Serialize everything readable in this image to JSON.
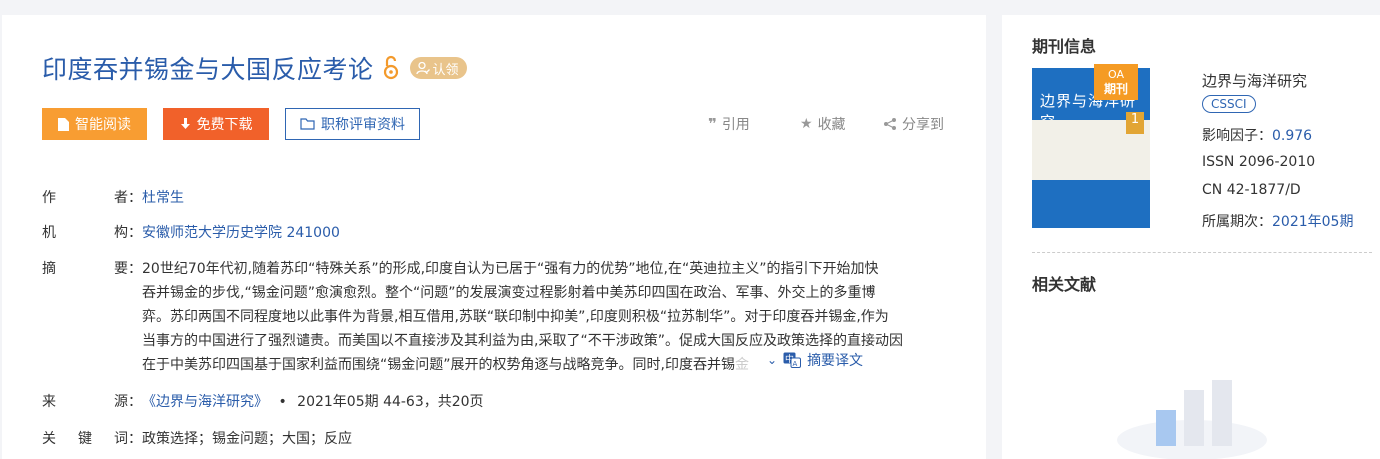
{
  "article": {
    "title": "印度吞并锡金与大国反应考论",
    "claim_label": "认领",
    "buttons": {
      "read": "智能阅读",
      "download": "免费下载",
      "title_material": "职称评审资料"
    },
    "actions": {
      "cite": "引用",
      "favorite": "收藏",
      "share": "分享到"
    },
    "labels": {
      "author": [
        "作",
        "者："
      ],
      "org": [
        "机",
        "构："
      ],
      "abstract": [
        "摘",
        "要："
      ],
      "source": [
        "来",
        "源："
      ],
      "keywords": [
        "关",
        "键",
        "词："
      ]
    },
    "author": "杜常生",
    "org": "安徽师范大学历史学院 241000",
    "abstract_lines": [
      "20世纪70年代初,随着苏印“特殊关系”的形成,印度自认为已居于“强有力的优势”地位,在“英迪拉主义”的指引下开始加快",
      "吞并锡金的步伐,“锡金问题”愈演愈烈。整个“问题”的发展演变过程影射着中美苏印四国在政治、军事、外交上的多重博",
      "弈。苏印两国不同程度地以此事件为背景,相互借用,苏联“联印制中抑美”,印度则积极“拉苏制华”。对于印度吞并锡金,作为",
      "当事方的中国进行了强烈谴责。而美国以不直接涉及其利益为由,采取了“不干涉政策”。促成大国反应及政策选择的直接动因",
      "在于中美苏印四国基于国家利益而围绕“锡金问题”展开的权势角逐与战略竞争。同时,印度吞并锡"
    ],
    "abstract_fade": "金",
    "translate_label": "摘要译文",
    "source_journal": "《边界与海洋研究》",
    "source_issue": "2021年05期 44-63，共20页",
    "keywords": "政策选择；锡金问题；大国；反应"
  },
  "journal": {
    "section_title": "期刊信息",
    "name": "边界与海洋研究",
    "cover_title": "边界与海洋研究",
    "cover_issue": "1",
    "oa_badge_top": "OA",
    "oa_badge_bottom": "期刊",
    "index_tag": "CSSCI",
    "impact_label": "影响因子：",
    "impact_value": "0.976",
    "issn": "ISSN 2096-2010",
    "cn": "CN 42-1877/D",
    "issue_label": "所属期次：",
    "issue_value": "2021年05期"
  },
  "related": {
    "section_title": "相关文献"
  },
  "colors": {
    "brand": "#2a5caa",
    "read_button": "#f89d32",
    "download_button": "#f1612a",
    "claim": "#e9c48b"
  }
}
